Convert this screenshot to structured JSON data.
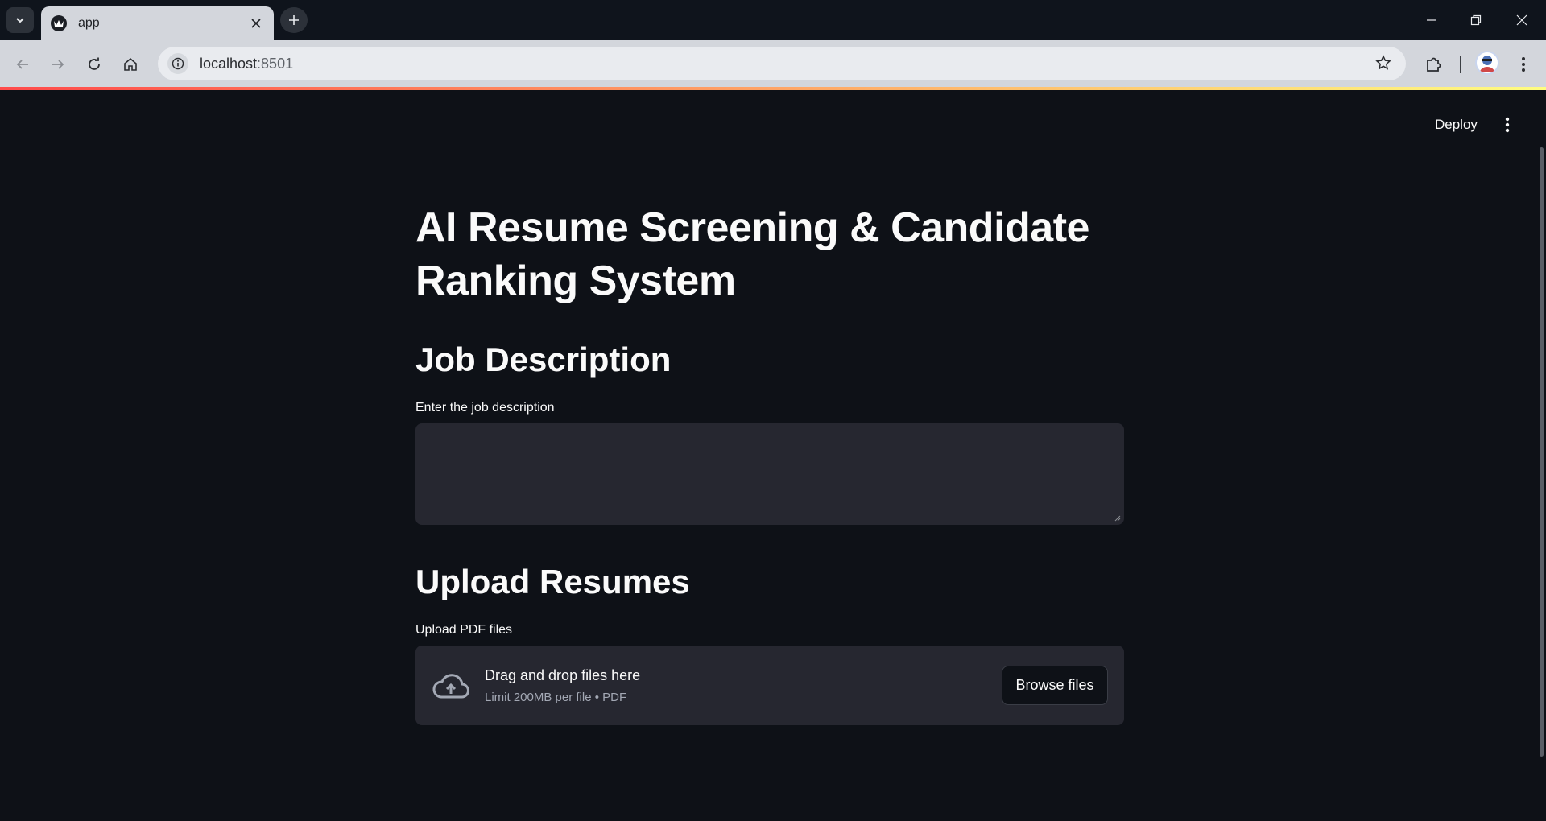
{
  "browser": {
    "tab_title": "app",
    "url_host": "localhost",
    "url_port": ":8501"
  },
  "app_header": {
    "deploy_label": "Deploy"
  },
  "main": {
    "title": "AI Resume Screening & Candidate Ranking System",
    "job_section": {
      "heading": "Job Description",
      "field_label": "Enter the job description",
      "value": ""
    },
    "upload_section": {
      "heading": "Upload Resumes",
      "field_label": "Upload PDF files",
      "drop_text": "Drag and drop files here",
      "limit_text": "Limit 200MB per file • PDF",
      "browse_label": "Browse files"
    }
  },
  "colors": {
    "background": "#0e1117",
    "widget_bg": "#262730",
    "text": "#fafafa",
    "accent_gradient_start": "#ff4b4b",
    "accent_gradient_end": "#fffd80"
  },
  "icons": [
    "tab-search-icon",
    "streamlit-favicon-icon",
    "close-icon",
    "plus-icon",
    "minimize-icon",
    "restore-icon",
    "window-close-icon",
    "back-icon",
    "forward-icon",
    "reload-icon",
    "home-icon",
    "site-info-icon",
    "star-icon",
    "extensions-icon",
    "profile-avatar",
    "more-vert-icon",
    "kebab-menu-icon",
    "cloud-upload-icon"
  ]
}
